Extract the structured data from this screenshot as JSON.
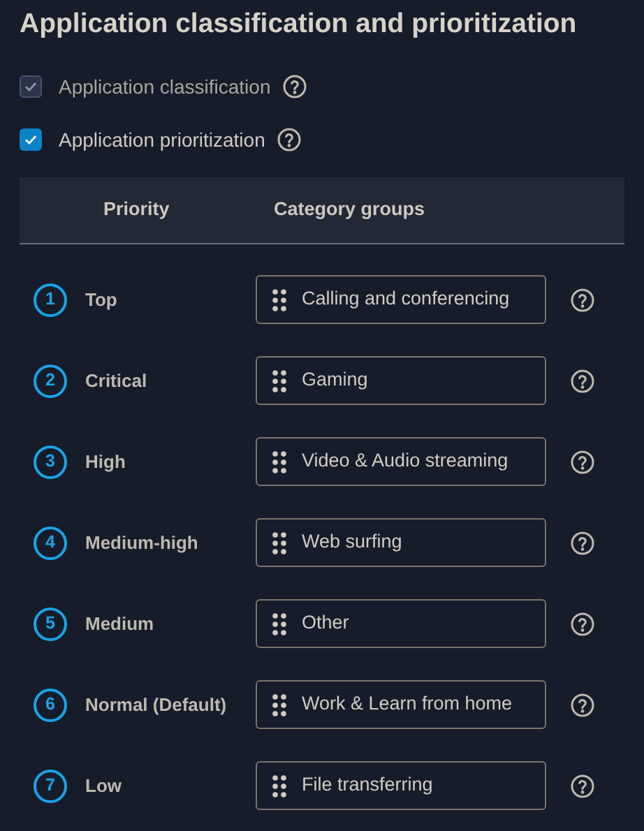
{
  "title": "Application classification and prioritization",
  "options": [
    {
      "label": "Application classification",
      "checked": true,
      "disabled": true
    },
    {
      "label": "Application prioritization",
      "checked": true,
      "disabled": false
    }
  ],
  "table": {
    "columns": [
      "Priority",
      "Category groups"
    ],
    "rows": [
      {
        "number": "1",
        "priority": "Top",
        "category": "Calling and conferencing"
      },
      {
        "number": "2",
        "priority": "Critical",
        "category": "Gaming"
      },
      {
        "number": "3",
        "priority": "High",
        "category": "Video & Audio streaming"
      },
      {
        "number": "4",
        "priority": "Medium-high",
        "category": "Web surfing"
      },
      {
        "number": "5",
        "priority": "Medium",
        "category": "Other"
      },
      {
        "number": "6",
        "priority": "Normal (Default)",
        "category": "Work & Learn from home"
      },
      {
        "number": "7",
        "priority": "Low",
        "category": "File transferring"
      }
    ]
  }
}
